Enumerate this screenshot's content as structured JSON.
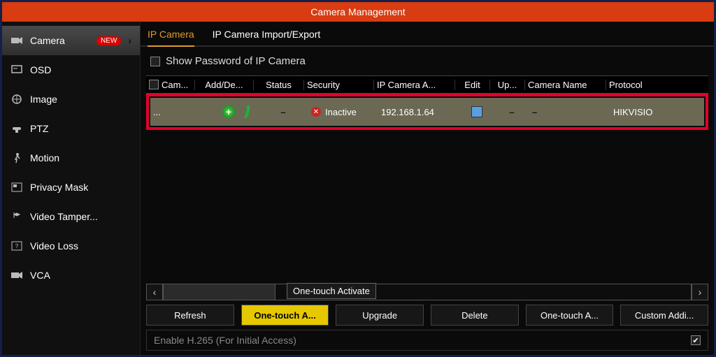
{
  "title": "Camera Management",
  "sidebar": {
    "items": [
      {
        "label": "Camera",
        "active": true,
        "badge": "NEW"
      },
      {
        "label": "OSD"
      },
      {
        "label": "Image"
      },
      {
        "label": "PTZ"
      },
      {
        "label": "Motion"
      },
      {
        "label": "Privacy Mask"
      },
      {
        "label": "Video Tamper..."
      },
      {
        "label": "Video Loss"
      },
      {
        "label": "VCA"
      }
    ]
  },
  "tabs": {
    "ip_camera": "IP Camera",
    "import_export": "IP Camera Import/Export"
  },
  "show_password_label": "Show Password of IP Camera",
  "columns": {
    "cam": "Cam...",
    "add": "Add/De...",
    "status": "Status",
    "security": "Security",
    "ip": "IP Camera A...",
    "edit": "Edit",
    "up": "Up...",
    "name": "Camera Name",
    "protocol": "Protocol"
  },
  "row": {
    "cam": "...",
    "status": "–",
    "security": "Inactive",
    "ip": "192.168.1.64",
    "up": "–",
    "name": "–",
    "protocol": "HIKVISIO"
  },
  "tooltip": "One-touch Activate",
  "buttons": {
    "refresh": "Refresh",
    "one_touch_a": "One-touch A...",
    "upgrade": "Upgrade",
    "delete": "Delete",
    "one_touch_add": "One-touch A...",
    "custom_add": "Custom Addi..."
  },
  "enable_label": "Enable H.265 (For Initial Access)"
}
